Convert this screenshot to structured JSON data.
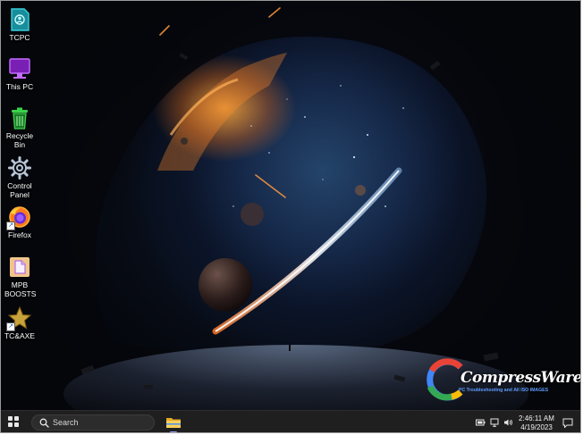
{
  "desktop": {
    "icons": [
      {
        "label": "TCPC",
        "icon": "user-folder-icon"
      },
      {
        "label": "This PC",
        "icon": "monitor-icon"
      },
      {
        "label": "Recycle Bin",
        "icon": "recycle-bin-icon"
      },
      {
        "label": "Control Panel",
        "icon": "gear-icon"
      },
      {
        "label": "Firefox",
        "icon": "firefox-icon"
      },
      {
        "label": "MPB BOOSTS",
        "icon": "file-icon"
      },
      {
        "label": "TC&AXE",
        "icon": "star-icon"
      }
    ]
  },
  "watermark": {
    "brand": "CompressWare",
    "tagline": "PC Troubleshooting and All ISO IMAGES"
  },
  "taskbar": {
    "search_label": "Search",
    "pinned": [
      {
        "name": "File Explorer",
        "icon": "folder-icon"
      }
    ],
    "tray": {
      "icons": [
        "battery-icon",
        "network-icon",
        "speaker-icon"
      ],
      "time": "2:46:11 AM",
      "date": "4/19/2023"
    },
    "notification_icon": "notification-icon"
  },
  "colors": {
    "taskbar_bg": "#1f1f1f",
    "accent": "#9aa8ff",
    "icon_teal": "#2bb3c0",
    "icon_purple": "#a646e8",
    "icon_green": "#3bd14b",
    "icon_gold": "#e0b838"
  }
}
